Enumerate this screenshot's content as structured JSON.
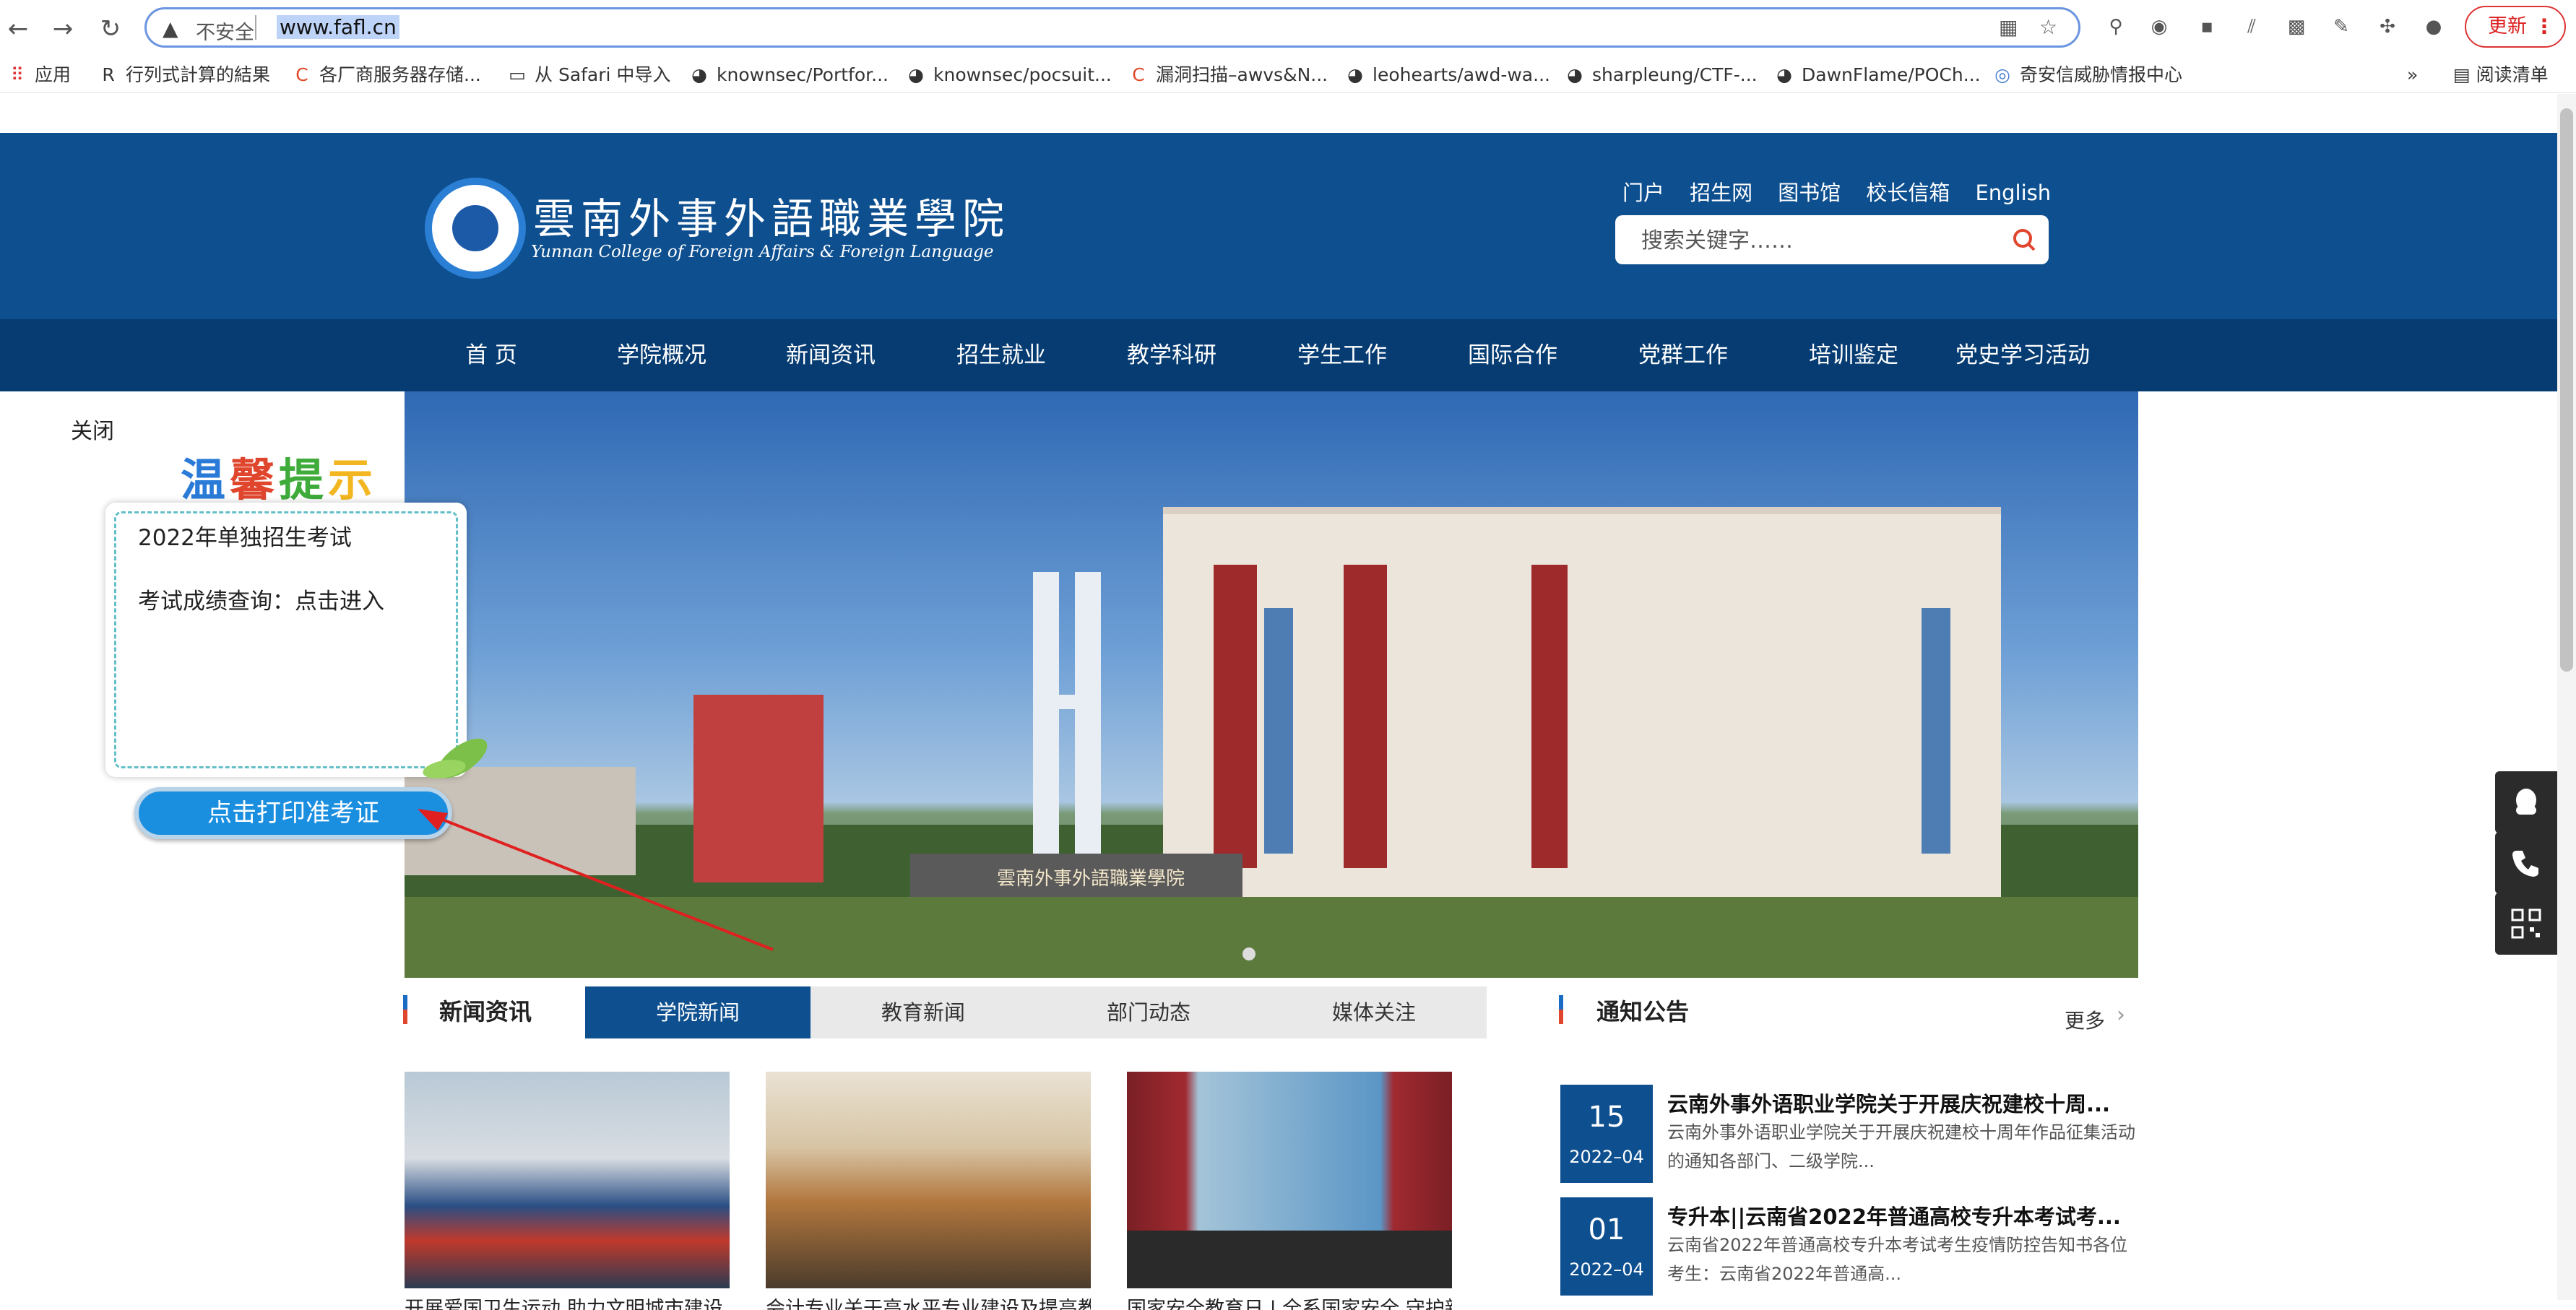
{
  "browser": {
    "nav": {
      "back": "←",
      "forward": "→",
      "reload": "↻"
    },
    "address": {
      "security_icon": "▲",
      "security_label": "不安全",
      "url": "www.fafl.cn"
    },
    "update_label": "更新",
    "bookmarks": [
      {
        "icon": "apps-grid-icon",
        "label": "应用"
      },
      {
        "icon": "r-icon",
        "label": "行列式計算的結果"
      },
      {
        "icon": "c-icon",
        "label": "各厂商服务器存储..."
      },
      {
        "icon": "folder-icon",
        "label": "从 Safari 中导入"
      },
      {
        "icon": "github-icon",
        "label": "knownsec/Portfor..."
      },
      {
        "icon": "github-icon",
        "label": "knownsec/pocsuit..."
      },
      {
        "icon": "c-icon",
        "label": "漏洞扫描–awvs&N..."
      },
      {
        "icon": "github-icon",
        "label": "leohearts/awd-wa..."
      },
      {
        "icon": "github-icon",
        "label": "sharpleung/CTF-..."
      },
      {
        "icon": "github-icon",
        "label": "DawnFlame/POCh..."
      },
      {
        "icon": "eye-icon",
        "label": "奇安信威胁情报中心"
      }
    ],
    "bookmarks_more": "»",
    "reading_list": "阅读清单"
  },
  "site": {
    "logo_cn": "雲南外事外語職業學院",
    "logo_en": "Yunnan College of Foreign Affairs & Foreign Language",
    "toplinks": [
      "门户",
      "招生网",
      "图书馆",
      "校长信箱",
      "English"
    ],
    "search_placeholder": "搜索关键字……",
    "nav": [
      "首 页",
      "学院概况",
      "新闻资讯",
      "招生就业",
      "教学科研",
      "学生工作",
      "国际合作",
      "党群工作",
      "培训鉴定",
      "党史学习活动"
    ],
    "hero_gate_text": "雲南外事外語職業學院"
  },
  "popup": {
    "close": "关闭",
    "title": [
      "温",
      "馨",
      "提",
      "示"
    ],
    "line1": "2022年单独招生考试",
    "line2": "考试成绩查询：点击进入",
    "print_button": "点击打印准考证"
  },
  "news": {
    "section_title": "新闻资讯",
    "tabs": [
      "学院新闻",
      "教育新闻",
      "部门动态",
      "媒体关注"
    ],
    "active_tab": 0,
    "items": [
      {
        "caption": "开展爱国卫生运动 助力文明城市建设"
      },
      {
        "caption": "会计专业关于高水平专业建设及提高教"
      },
      {
        "caption": "国家安全教育日 | 全系国家安全 守护新"
      }
    ]
  },
  "notices": {
    "section_title": "通知公告",
    "more": "更多",
    "items": [
      {
        "day": "15",
        "ym": "2022–04",
        "title": "云南外事外语职业学院关于开展庆祝建校十周...",
        "desc": "云南外事外语职业学院关于开展庆祝建校十周年作品征集活动的通知各部门、二级学院..."
      },
      {
        "day": "01",
        "ym": "2022–04",
        "title": "专升本||云南省2022年普通高校专升本考试考...",
        "desc": "云南省2022年普通高校专升本考试考生疫情防控告知书各位考生：云南省2022年普通高..."
      }
    ]
  },
  "colors": {
    "brand_blue": "#0d4f8f",
    "nav_blue": "#063c72",
    "accent_red": "#e0462d"
  }
}
